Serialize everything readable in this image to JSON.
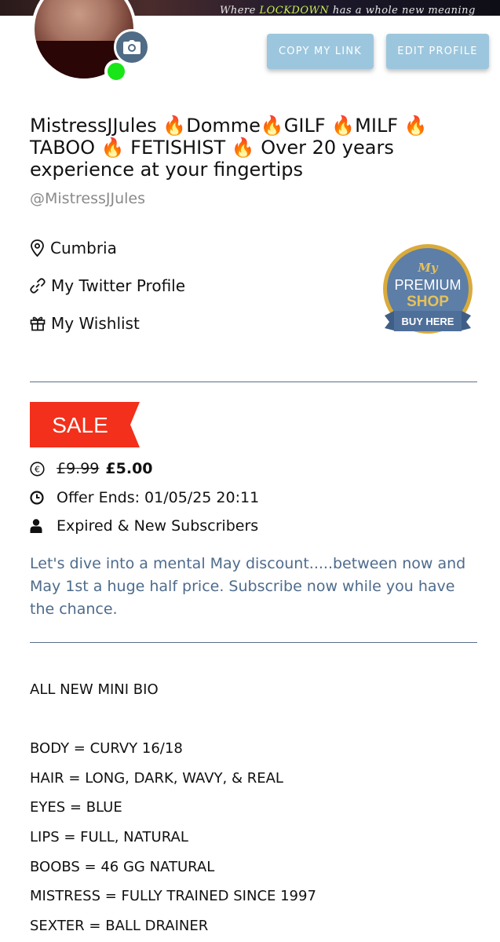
{
  "banner": {
    "text_before": "Where ",
    "text_highlight": "LOCKDOWN",
    "text_after": " has a whole new meaning"
  },
  "profile": {
    "camera_icon": "camera-icon",
    "status": "online",
    "status_color": "#19e619",
    "buttons": {
      "copy_link": "COPY MY LINK",
      "edit_profile": "EDIT PROFILE"
    },
    "title": "MistressJJules 🔥Domme🔥GILF 🔥MILF 🔥 TABOO 🔥 FETISHIST 🔥 Over 20 years experience at your fingertips",
    "handle": "@MistressJJules",
    "location": "Cumbria",
    "twitter_link": "My Twitter Profile",
    "wishlist_link": "My Wishlist",
    "shop_badge": {
      "my": "My",
      "premium": "PREMIUM",
      "shop": "SHOP",
      "ribbon": "BUY HERE"
    }
  },
  "sale": {
    "tag": "SALE",
    "tag_color": "#f2301b",
    "old_price": "£9.99",
    "new_price": "£5.00",
    "offer_ends": "Offer Ends: 01/05/25 20:11",
    "audience": "Expired & New Subscribers",
    "promo_text": "Let's dive into a mental May discount.....between now and May 1st a huge half price. Subscribe now while you have the chance."
  },
  "bio": {
    "heading": "ALL NEW MINI BIO",
    "lines": [
      "BODY = CURVY 16/18",
      "HAIR = LONG, DARK, WAVY, & REAL",
      "EYES = BLUE",
      "LIPS = FULL, NATURAL",
      "BOOBS = 46 GG NATURAL",
      "MISTRESS = FULLY TRAINED SINCE 1997",
      "SEXTER = BALL DRAINER"
    ]
  },
  "colors": {
    "button_bg": "#9cc6dd",
    "accent_blue": "#4e6b8c",
    "camera_bg": "#4f6b86"
  }
}
